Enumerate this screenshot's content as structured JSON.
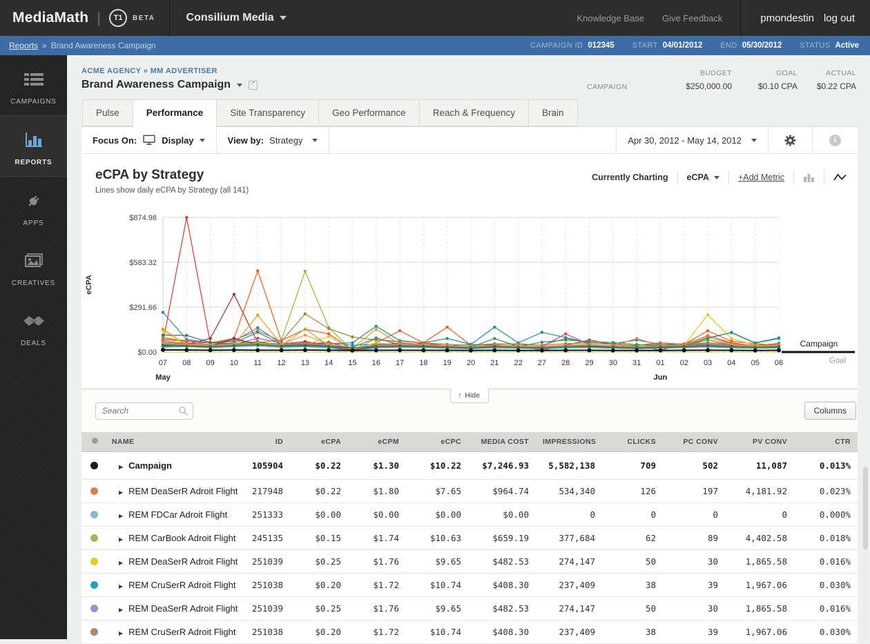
{
  "top_bar": {
    "brand": "MediaMath",
    "logo": "T1",
    "beta": "BETA",
    "account": "Consilium Media",
    "links": [
      "Knowledge Base",
      "Give Feedback"
    ],
    "user": "pmondestin",
    "logout": "log out"
  },
  "breadcrumb_bar": {
    "link": "Reports",
    "separator": "»",
    "current": "Brand Awareness Campaign",
    "meta": [
      {
        "label": "CAMPAIGN ID",
        "value": "012345"
      },
      {
        "label": "START",
        "value": "04/01/2012"
      },
      {
        "label": "END",
        "value": "05/30/2012"
      },
      {
        "label": "STATUS",
        "value": "Active"
      }
    ]
  },
  "sidebar": {
    "items": [
      {
        "label": "CAMPAIGNS",
        "icon": "list-icon",
        "active": false
      },
      {
        "label": "REPORTS",
        "icon": "bar-chart-icon",
        "active": true
      },
      {
        "label": "APPS",
        "icon": "plug-icon",
        "active": false
      },
      {
        "label": "CREATIVES",
        "icon": "image-icon",
        "active": false
      },
      {
        "label": "DEALS",
        "icon": "handshake-icon",
        "active": false
      }
    ]
  },
  "header": {
    "breadcrumb": "ACME AGENCY » MM ADVERTISER",
    "title": "Brand Awareness Campaign",
    "row_label": "CAMPAIGN",
    "stats": [
      {
        "label": "BUDGET",
        "value": "$250,000.00"
      },
      {
        "label": "GOAL",
        "value": "$0.10 CPA"
      },
      {
        "label": "ACTUAL",
        "value": "$0.22 CPA"
      }
    ]
  },
  "tabs": [
    {
      "label": "Pulse",
      "active": false
    },
    {
      "label": "Performance",
      "active": true
    },
    {
      "label": "Site Transparency",
      "active": false
    },
    {
      "label": "Geo Performance",
      "active": false
    },
    {
      "label": "Reach & Frequency",
      "active": false
    },
    {
      "label": "Brain",
      "active": false
    }
  ],
  "toolbar": {
    "focus_label": "Focus On:",
    "focus_value": "Display",
    "view_label": "View by:",
    "view_value": "Strategy",
    "date_range": "Apr 30, 2012 - May 14, 2012"
  },
  "chart_header": {
    "title": "eCPA by Strategy",
    "subtitle": "Lines show daily eCPA by Strategy (all 141)",
    "currently_charting": "Currently Charting",
    "metric": "eCPA",
    "add_metric": "+Add Metric"
  },
  "chart_data": {
    "type": "line",
    "title": "eCPA by Strategy",
    "ylabel": "eCPA",
    "ylim": [
      0,
      874.98
    ],
    "grid": true,
    "yticks": [
      {
        "label": "$0.00",
        "value": 0
      },
      {
        "label": "$291.66",
        "value": 291.66
      },
      {
        "label": "$583.32",
        "value": 583.32
      },
      {
        "label": "$874.98",
        "value": 874.98
      }
    ],
    "categories": [
      "07",
      "08",
      "09",
      "10",
      "11",
      "12",
      "13",
      "14",
      "15",
      "16",
      "17",
      "18",
      "19",
      "20",
      "21",
      "22",
      "27",
      "28",
      "29",
      "30",
      "31",
      "01",
      "02",
      "03",
      "04",
      "05",
      "06"
    ],
    "month_labels": [
      {
        "label": "May",
        "index": 0
      },
      {
        "label": "Jun",
        "index": 21
      }
    ],
    "right_labels": {
      "above": "Campaign",
      "below": "Goal"
    },
    "series": [
      {
        "name": "strategy-red",
        "color": "#d23b2e",
        "values": [
          62,
          874.98,
          58,
          85,
          52,
          45,
          60,
          42,
          8,
          50,
          45,
          58,
          40,
          34,
          30,
          42,
          10,
          45,
          78,
          50,
          40,
          12,
          50,
          105,
          60,
          40,
          55
        ]
      },
      {
        "name": "strategy-crimson",
        "color": "#a8322c",
        "values": [
          45,
          52,
          88,
          375,
          60,
          52,
          68,
          45,
          12,
          40,
          52,
          44,
          34,
          30,
          40,
          34,
          30,
          40,
          44,
          34,
          30,
          34,
          44,
          40,
          34,
          30,
          40
        ]
      },
      {
        "name": "strategy-orangered",
        "color": "#ef5a23",
        "values": [
          80,
          70,
          60,
          88,
          528,
          74,
          148,
          118,
          14,
          60,
          138,
          60,
          162,
          44,
          50,
          54,
          44,
          88,
          60,
          50,
          44,
          60,
          50,
          138,
          70,
          54,
          44
        ]
      },
      {
        "name": "strategy-olive",
        "color": "#a8ad3a",
        "values": [
          100,
          60,
          50,
          70,
          62,
          78,
          525,
          158,
          10,
          88,
          60,
          50,
          40,
          34,
          44,
          40,
          34,
          44,
          50,
          40,
          34,
          40,
          44,
          60,
          50,
          44,
          38
        ]
      },
      {
        "name": "strategy-blue",
        "color": "#3d7cc9",
        "values": [
          258,
          82,
          60,
          70,
          158,
          54,
          50,
          60,
          44,
          50,
          54,
          44,
          40,
          50,
          44,
          40,
          34,
          44,
          40,
          34,
          30,
          40,
          44,
          50,
          40,
          34,
          58
        ]
      },
      {
        "name": "strategy-teal",
        "color": "#17929e",
        "values": [
          50,
          54,
          44,
          60,
          128,
          50,
          44,
          54,
          60,
          168,
          74,
          60,
          88,
          50,
          162,
          60,
          128,
          94,
          60,
          54,
          78,
          50,
          44,
          88,
          128,
          60,
          92
        ]
      },
      {
        "name": "strategy-brown",
        "color": "#b5793b",
        "values": [
          88,
          74,
          60,
          78,
          138,
          70,
          248,
          152,
          98,
          78,
          70,
          60,
          50,
          44,
          54,
          50,
          44,
          54,
          60,
          50,
          44,
          50,
          54,
          60,
          50,
          44,
          54
        ]
      },
      {
        "name": "strategy-yellow",
        "color": "#e7c217",
        "values": [
          138,
          40,
          34,
          44,
          40,
          50,
          44,
          102,
          12,
          60,
          44,
          40,
          34,
          30,
          40,
          34,
          30,
          40,
          44,
          34,
          50,
          34,
          44,
          242,
          88,
          44,
          40
        ]
      },
      {
        "name": "strategy-magenta",
        "color": "#c94691",
        "values": [
          70,
          55,
          62,
          48,
          90,
          58,
          52,
          64,
          20,
          46,
          58,
          48,
          40,
          36,
          44,
          40,
          36,
          118,
          48,
          40,
          36,
          40,
          46,
          52,
          44,
          38,
          46
        ]
      },
      {
        "name": "strategy-green",
        "color": "#4d9e4d",
        "values": [
          58,
          48,
          42,
          54,
          68,
          46,
          52,
          44,
          16,
          40,
          46,
          42,
          36,
          32,
          40,
          36,
          32,
          40,
          44,
          36,
          32,
          36,
          42,
          78,
          46,
          40,
          36
        ]
      },
      {
        "name": "strategy-purple",
        "color": "#8071bd",
        "values": [
          42,
          52,
          38,
          46,
          56,
          42,
          46,
          40,
          10,
          36,
          42,
          38,
          32,
          28,
          36,
          32,
          28,
          36,
          40,
          32,
          28,
          32,
          38,
          44,
          36,
          32,
          34
        ]
      },
      {
        "name": "strategy-slate",
        "color": "#50607a",
        "values": [
          110,
          108,
          62,
          52,
          48,
          44,
          52,
          46,
          24,
          42,
          46,
          42,
          38,
          34,
          40,
          36,
          32,
          38,
          42,
          36,
          32,
          36,
          40,
          44,
          38,
          34,
          38
        ]
      },
      {
        "name": "strategy-lightblue",
        "color": "#62b4dc",
        "values": [
          34,
          40,
          32,
          38,
          44,
          34,
          38,
          32,
          8,
          30,
          34,
          32,
          28,
          24,
          30,
          28,
          24,
          30,
          32,
          28,
          24,
          28,
          32,
          36,
          30,
          28,
          30
        ]
      },
      {
        "name": "strategy-orange",
        "color": "#f19a2c",
        "values": [
          150,
          46,
          40,
          46,
          240,
          50,
          110,
          52,
          26,
          148,
          52,
          46,
          40,
          36,
          42,
          38,
          34,
          42,
          46,
          38,
          34,
          38,
          44,
          96,
          48,
          40,
          42
        ]
      },
      {
        "name": "strategy-seagreen",
        "color": "#2f9467",
        "values": [
          48,
          44,
          38,
          46,
          52,
          42,
          46,
          40,
          30,
          92,
          46,
          42,
          36,
          32,
          88,
          36,
          64,
          78,
          68,
          62,
          48,
          42,
          38,
          92,
          126,
          58,
          88
        ]
      },
      {
        "name": "strategy-salmon",
        "color": "#e07b54",
        "values": [
          66,
          52,
          46,
          54,
          60,
          48,
          54,
          46,
          18,
          44,
          50,
          46,
          40,
          36,
          44,
          40,
          36,
          44,
          48,
          40,
          88,
          40,
          46,
          108,
          52,
          44,
          46
        ]
      },
      {
        "name": "strategy-maroon",
        "color": "#8e3557",
        "values": [
          38,
          44,
          34,
          90,
          48,
          38,
          42,
          36,
          14,
          34,
          38,
          36,
          30,
          26,
          34,
          30,
          26,
          34,
          36,
          30,
          26,
          30,
          34,
          40,
          34,
          30,
          32
        ]
      },
      {
        "name": "strategy-gold",
        "color": "#c2a23c",
        "values": [
          54,
          46,
          40,
          48,
          54,
          44,
          150,
          42,
          22,
          40,
          46,
          42,
          36,
          32,
          38,
          34,
          30,
          38,
          42,
          34,
          30,
          34,
          40,
          46,
          40,
          34,
          36
        ]
      },
      {
        "name": "strategy-skyblue",
        "color": "#49a8c8",
        "values": [
          30,
          36,
          28,
          34,
          40,
          30,
          34,
          28,
          6,
          26,
          30,
          28,
          24,
          20,
          26,
          24,
          20,
          26,
          28,
          24,
          20,
          24,
          28,
          32,
          26,
          24,
          26
        ]
      },
      {
        "name": "strategy-darkgreen",
        "color": "#1f7a4d",
        "values": [
          44,
          38,
          34,
          42,
          48,
          38,
          42,
          36,
          28,
          36,
          40,
          38,
          32,
          28,
          36,
          30,
          28,
          34,
          38,
          32,
          28,
          32,
          36,
          42,
          36,
          30,
          34
        ]
      },
      {
        "name": "Goal",
        "color": "#e7c217",
        "dash": true,
        "markers": false,
        "values": [
          0.1,
          0.1,
          0.1,
          0.1,
          0.1,
          0.1,
          0.1,
          0.1,
          0.1,
          0.1,
          0.1,
          0.1,
          0.1,
          0.1,
          0.1,
          0.1,
          0.1,
          0.1,
          0.1,
          0.1,
          0.1,
          0.1,
          0.1,
          0.1,
          0.1,
          0.1,
          0.1
        ]
      },
      {
        "name": "Campaign",
        "color": "#111111",
        "width": 2,
        "values": [
          14,
          13,
          12,
          13,
          12,
          12,
          13,
          12,
          10,
          11,
          12,
          11,
          11,
          10,
          11,
          10,
          10,
          11,
          11,
          10,
          10,
          10,
          11,
          12,
          11,
          10,
          11
        ]
      }
    ]
  },
  "table_controls": {
    "hide_label": "Hide",
    "search_placeholder": "Search",
    "columns_label": "Columns"
  },
  "table": {
    "columns": [
      "NAME",
      "ID",
      "eCPA",
      "eCPM",
      "eCPC",
      "MEDIA COST",
      "IMPRESSIONS",
      "CLICKS",
      "PC CONV",
      "PV CONV",
      "CTR"
    ],
    "rows": [
      {
        "dot": "#1a1a1a",
        "bold": true,
        "name": "Campaign",
        "values": [
          "105904",
          "$0.22",
          "$1.30",
          "$10.22",
          "$7,246.93",
          "5,582,138",
          "709",
          "502",
          "11,087",
          "0.013%"
        ]
      },
      {
        "dot": "#e07a51",
        "bold": false,
        "name": "REM DeaSerR Adroit Flight",
        "values": [
          "217948",
          "$0.22",
          "$1.80",
          "$7.65",
          "$964.74",
          "534,340",
          "126",
          "197",
          "4,181.92",
          "0.023%"
        ]
      },
      {
        "dot": "#8fb8c6",
        "bold": false,
        "name": "REM FDCar Adroit Flight",
        "values": [
          "251333",
          "$0.00",
          "$0.00",
          "$0.00",
          "$0.00",
          "0",
          "0",
          "0",
          "0",
          "0.000%"
        ]
      },
      {
        "dot": "#b0b05a",
        "bold": false,
        "name": "REM CarBook Adroit Flight",
        "values": [
          "245135",
          "$0.15",
          "$1.74",
          "$10.63",
          "$659.19",
          "377,684",
          "62",
          "89",
          "4,402.58",
          "0.018%"
        ]
      },
      {
        "dot": "#e6c832",
        "bold": false,
        "name": "REM DeaSerR Adroit Flight",
        "values": [
          "251039",
          "$0.25",
          "$1.76",
          "$9.65",
          "$482.53",
          "274,147",
          "50",
          "30",
          "1,865.58",
          "0.016%"
        ]
      },
      {
        "dot": "#29a0b5",
        "bold": false,
        "name": "REM CruSerR Adroit Flight",
        "values": [
          "251038",
          "$0.20",
          "$1.72",
          "$10.74",
          "$408.30",
          "237,409",
          "38",
          "39",
          "1,967.06",
          "0.030%"
        ]
      },
      {
        "dot": "#8e96cf",
        "bold": false,
        "name": "REM DeaSerR Adroit Flight",
        "values": [
          "251039",
          "$0.25",
          "$1.76",
          "$9.65",
          "$482.53",
          "274,147",
          "50",
          "30",
          "1,865.58",
          "0.016%"
        ]
      },
      {
        "dot": "#a58a70",
        "bold": false,
        "name": "REM CruSerR Adroit Flight",
        "values": [
          "251038",
          "$0.20",
          "$1.72",
          "$10.74",
          "$408.30",
          "237,409",
          "38",
          "39",
          "1,967.06",
          "0.030%"
        ]
      }
    ]
  }
}
